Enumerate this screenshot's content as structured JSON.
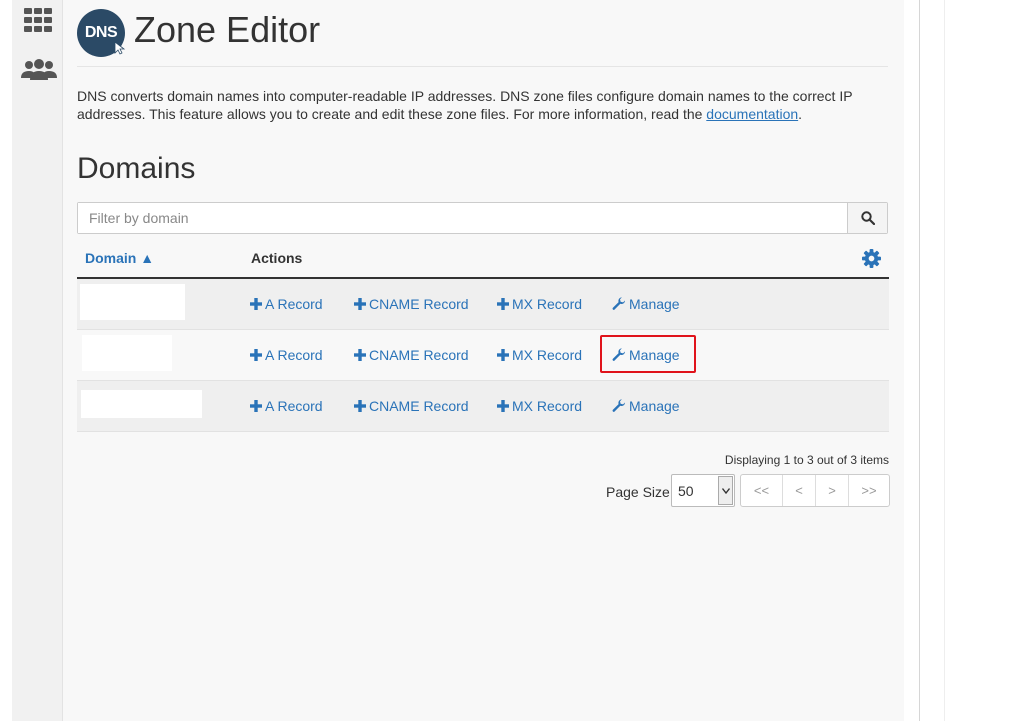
{
  "sidebar": {
    "icons": [
      {
        "name": "apps-grid-icon"
      },
      {
        "name": "users-icon"
      }
    ]
  },
  "header": {
    "logo_text": "DNS",
    "title": "Zone Editor"
  },
  "intro": {
    "text": "DNS converts domain names into computer-readable IP addresses. DNS zone files configure domain names to the correct IP addresses. This feature allows you to create and edit these zone files. For more information, read the ",
    "link_text": "documentation",
    "suffix": "."
  },
  "domains": {
    "section_title": "Domains",
    "filter_placeholder": "Filter by domain",
    "columns": {
      "domain": "Domain ▲",
      "actions": "Actions"
    },
    "rows": [
      {
        "domain": "",
        "a_record": "A Record",
        "cname_record": "CNAME Record",
        "mx_record": "MX Record",
        "manage": "Manage"
      },
      {
        "domain": "",
        "a_record": "A Record",
        "cname_record": "CNAME Record",
        "mx_record": "MX Record",
        "manage": "Manage"
      },
      {
        "domain": "",
        "a_record": "A Record",
        "cname_record": "CNAME Record",
        "mx_record": "MX Record",
        "manage": "Manage"
      }
    ]
  },
  "pagination": {
    "display_text": "Displaying 1 to 3 out of 3 items",
    "page_size_label": "Page Size",
    "page_size_value": "50",
    "buttons": [
      "<<",
      "<",
      ">",
      ">>"
    ]
  },
  "colors": {
    "link": "#2a73b8",
    "highlight": "#e0131b"
  }
}
